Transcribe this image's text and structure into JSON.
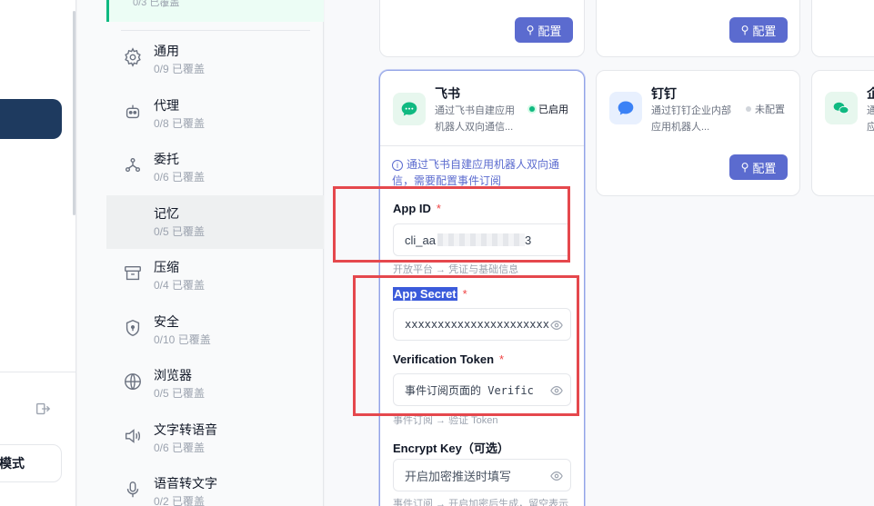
{
  "sidebar": {
    "mode_label": "模式",
    "top_item_sub": "0/3 已覆盖"
  },
  "categories": [
    {
      "name": "通用",
      "sub": "0/9 已覆盖",
      "icon": "gear-icon"
    },
    {
      "name": "代理",
      "sub": "0/8 已覆盖",
      "icon": "robot-icon"
    },
    {
      "name": "委托",
      "sub": "0/6 已覆盖",
      "icon": "network-icon"
    },
    {
      "name": "记忆",
      "sub": "0/5 已覆盖",
      "icon": "memory-icon",
      "selected": true
    },
    {
      "name": "压缩",
      "sub": "0/4 已覆盖",
      "icon": "archive-icon"
    },
    {
      "name": "安全",
      "sub": "0/10 已覆盖",
      "icon": "shield-icon"
    },
    {
      "name": "浏览器",
      "sub": "0/5 已覆盖",
      "icon": "globe-icon"
    },
    {
      "name": "文字转语音",
      "sub": "0/6 已覆盖",
      "icon": "speaker-icon"
    },
    {
      "name": "语音转文字",
      "sub": "0/2 已覆盖",
      "icon": "mic-icon"
    }
  ],
  "configure_label": "配置",
  "feishu": {
    "title": "飞书",
    "desc": "通过飞书自建应用机器人双向通信...",
    "status": "已启用",
    "status_color": "#10b981",
    "info": "通过飞书自建应用机器人双向通信，需要配置事件订阅",
    "fields": {
      "app_id": {
        "label": "App ID",
        "value": "cli_aa",
        "tail": "3",
        "hint": "开放平台 → 凭证与基础信息"
      },
      "app_secret": {
        "label": "App Secret",
        "value": "xxxxxxxxxxxxxxxxxxxxxx"
      },
      "verification_token": {
        "label": "Verification Token",
        "placeholder": "事件订阅页面的 Verific",
        "hint": "事件订阅 → 验证 Token"
      },
      "encrypt_key": {
        "label": "Encrypt Key（可选）",
        "placeholder": "开启加密推送时填写",
        "hint": "事件订阅 → 开启加密后生成，留空表示"
      }
    }
  },
  "dingtalk": {
    "title": "钉钉",
    "desc": "通过钉钉企业内部应用机器人...",
    "status": "未配置",
    "status_color": "#d1d5db"
  },
  "wecom": {
    "title": "企"
  },
  "colors": {
    "accent": "#5b6bcf",
    "required": "#ef4444",
    "annotation": "#e5484d"
  }
}
